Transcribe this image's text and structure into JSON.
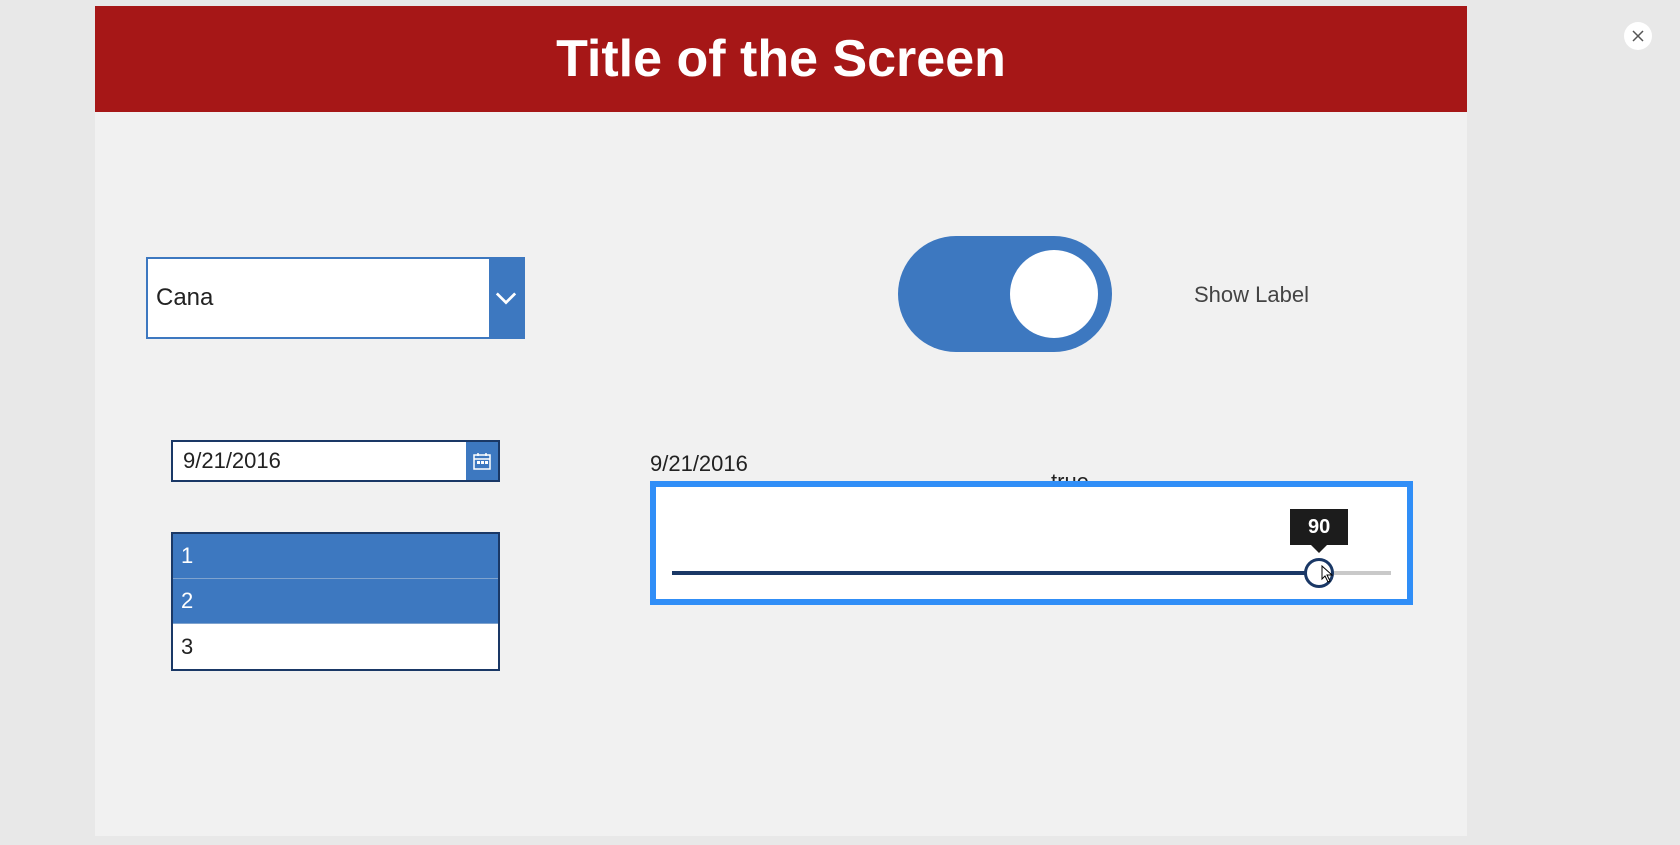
{
  "header": {
    "title": "Title of the Screen"
  },
  "combo": {
    "text": "Cana"
  },
  "toggle": {
    "on": true,
    "label": "Show Label"
  },
  "datepicker": {
    "value": "9/21/2016"
  },
  "date_display": "9/21/2016",
  "bool_display": "true",
  "listbox": {
    "items": [
      {
        "label": "1",
        "selected": true
      },
      {
        "label": "2",
        "selected": true
      },
      {
        "label": "3",
        "selected": false
      }
    ]
  },
  "slider": {
    "value": 90,
    "min": 0,
    "max": 100,
    "tooltip": "90"
  },
  "colors": {
    "header": "#a61717",
    "accent": "#3d78c0",
    "dark_accent": "#1a3866",
    "selection": "#308ef7"
  }
}
